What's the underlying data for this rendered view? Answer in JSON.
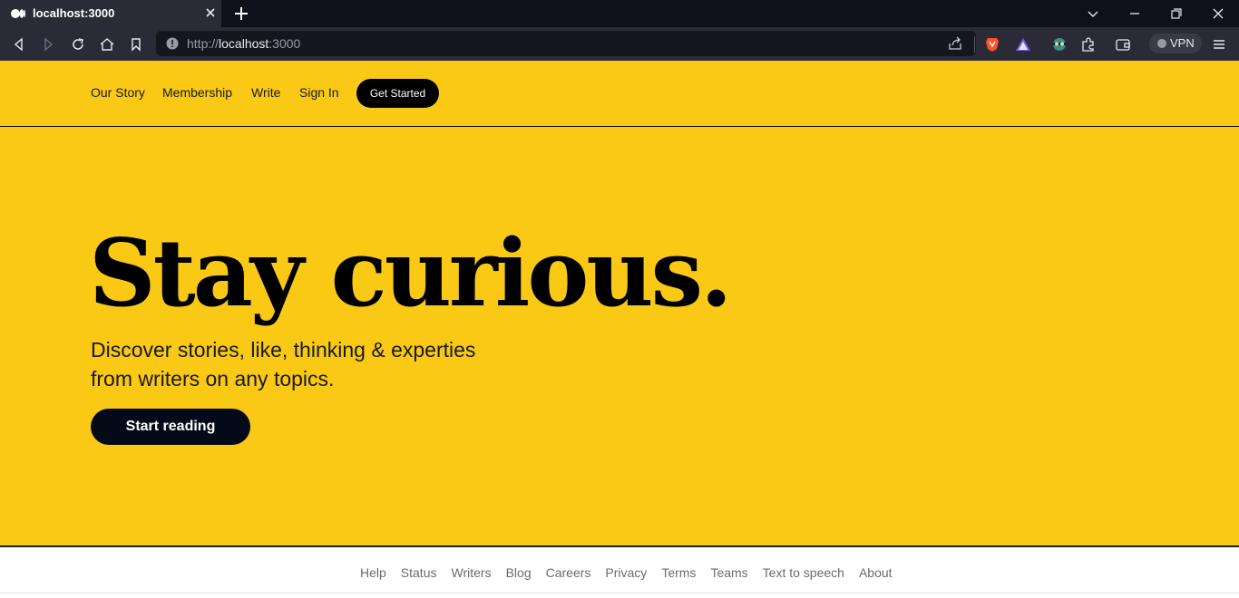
{
  "browser": {
    "tab_title": "localhost:3000",
    "url_scheme": "http://",
    "url_host": "localhost",
    "url_port": ":3000",
    "vpn_label": "VPN",
    "alert_badge_count": "1"
  },
  "header": {
    "nav": [
      {
        "label": "Our Story"
      },
      {
        "label": "Membership"
      },
      {
        "label": "Write"
      },
      {
        "label": "Sign In"
      }
    ],
    "cta_label": "Get Started"
  },
  "hero": {
    "title": "Stay curious.",
    "subtitle_line1": "Discover stories, like, thinking & experties",
    "subtitle_line2": "from writers on any topics.",
    "button_label": "Start reading"
  },
  "footer": {
    "links": [
      {
        "label": "Help"
      },
      {
        "label": "Status"
      },
      {
        "label": "Writers"
      },
      {
        "label": "Blog"
      },
      {
        "label": "Careers"
      },
      {
        "label": "Privacy"
      },
      {
        "label": "Terms"
      },
      {
        "label": "Teams"
      },
      {
        "label": "Text to speech"
      },
      {
        "label": "About"
      }
    ]
  },
  "colors": {
    "brand_yellow": "#fac915",
    "button_dark": "#050a19",
    "chrome_dark": "#10101a",
    "chrome_mid": "#2a2b36"
  }
}
